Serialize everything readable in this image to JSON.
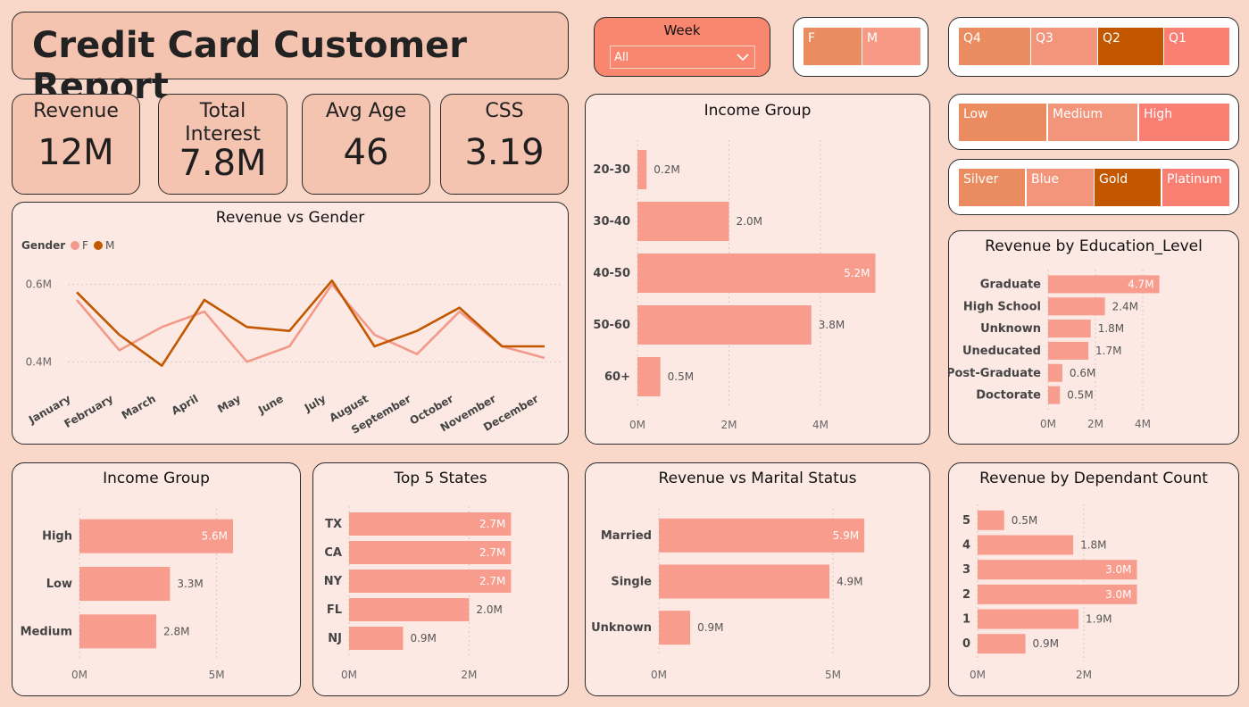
{
  "header": {
    "title": "Credit Card Customer Report"
  },
  "week_filter": {
    "label": "Week",
    "value": "All"
  },
  "gender_slicer": [
    {
      "label": "F",
      "color": "#ea8c60"
    },
    {
      "label": "M",
      "color": "#f79a85"
    }
  ],
  "quarter_slicer": [
    {
      "label": "Q4",
      "color": "#ea8c60"
    },
    {
      "label": "Q3",
      "color": "#f3957b"
    },
    {
      "label": "Q2",
      "color": "#c25700"
    },
    {
      "label": "Q1",
      "color": "#f87f72"
    }
  ],
  "income_slicer": [
    {
      "label": "Low",
      "color": "#ea8c60"
    },
    {
      "label": "Medium",
      "color": "#f3957b"
    },
    {
      "label": "High",
      "color": "#f87f72"
    }
  ],
  "card_slicer": [
    {
      "label": "Silver",
      "color": "#ea8c60"
    },
    {
      "label": "Blue",
      "color": "#f3957b"
    },
    {
      "label": "Gold",
      "color": "#c25700"
    },
    {
      "label": "Platinum",
      "color": "#f87f72"
    }
  ],
  "kpis": [
    {
      "label": "Revenue",
      "value": "12M"
    },
    {
      "label": "Total Interest",
      "value": "7.8M"
    },
    {
      "label": "Avg Age",
      "value": "46"
    },
    {
      "label": "CSS",
      "value": "3.19"
    }
  ],
  "colors": {
    "bar": "#f89c8e",
    "F": "#f2998a",
    "M": "#c25700"
  },
  "chart_data": [
    {
      "type": "line",
      "title": "Revenue vs Gender",
      "legend_title": "Gender",
      "legend_position": "top-left",
      "categories": [
        "January",
        "February",
        "March",
        "April",
        "May",
        "June",
        "July",
        "August",
        "September",
        "October",
        "November",
        "December"
      ],
      "series": [
        {
          "name": "F",
          "values": [
            0.56,
            0.43,
            0.49,
            0.53,
            0.4,
            0.44,
            0.6,
            0.47,
            0.42,
            0.53,
            0.44,
            0.41
          ]
        },
        {
          "name": "M",
          "values": [
            0.58,
            0.47,
            0.39,
            0.56,
            0.49,
            0.48,
            0.61,
            0.44,
            0.48,
            0.54,
            0.44,
            0.44
          ]
        }
      ],
      "y_ticks": [
        "0.4M",
        "0.6M"
      ],
      "ylim": [
        0.35,
        0.65
      ]
    },
    {
      "type": "bar",
      "orientation": "horizontal",
      "title": "Income Group",
      "categories": [
        "20-30",
        "30-40",
        "40-50",
        "50-60",
        "60+"
      ],
      "values": [
        0.2,
        2.0,
        5.2,
        3.8,
        0.5
      ],
      "labels": [
        "0.2M",
        "2.0M",
        "5.2M",
        "3.8M",
        "0.5M"
      ],
      "x_ticks": [
        "0M",
        "2M",
        "4M"
      ],
      "xlim": [
        0,
        5.6
      ]
    },
    {
      "type": "bar",
      "orientation": "horizontal",
      "title": "Revenue by Education_Level",
      "categories": [
        "Graduate",
        "High School",
        "Unknown",
        "Uneducated",
        "Post-Graduate",
        "Doctorate"
      ],
      "values": [
        4.7,
        2.4,
        1.8,
        1.7,
        0.6,
        0.5
      ],
      "labels": [
        "4.7M",
        "2.4M",
        "1.8M",
        "1.7M",
        "0.6M",
        "0.5M"
      ],
      "x_ticks": [
        "0M",
        "2M",
        "4M"
      ],
      "xlim": [
        0,
        6
      ]
    },
    {
      "type": "bar",
      "orientation": "horizontal",
      "title": "Income Group",
      "categories": [
        "High",
        "Low",
        "Medium"
      ],
      "values": [
        5.6,
        3.3,
        2.8
      ],
      "labels": [
        "5.6M",
        "3.3M",
        "2.8M"
      ],
      "x_ticks": [
        "0M",
        "5M"
      ],
      "xlim": [
        0,
        7
      ]
    },
    {
      "type": "bar",
      "orientation": "horizontal",
      "title": "Top 5 States",
      "categories": [
        "TX",
        "CA",
        "NY",
        "FL",
        "NJ"
      ],
      "values": [
        2.7,
        2.7,
        2.7,
        2.0,
        0.9
      ],
      "labels": [
        "2.7M",
        "2.7M",
        "2.7M",
        "2.0M",
        "0.9M"
      ],
      "x_ticks": [
        "0M",
        "2M"
      ],
      "xlim": [
        0,
        3.2
      ]
    },
    {
      "type": "bar",
      "orientation": "horizontal",
      "title": "Revenue vs Marital Status",
      "categories": [
        "Married",
        "Single",
        "Unknown"
      ],
      "values": [
        5.9,
        4.9,
        0.9
      ],
      "labels": [
        "5.9M",
        "4.9M",
        "0.9M"
      ],
      "x_ticks": [
        "0M",
        "5M"
      ],
      "xlim": [
        0,
        7
      ]
    },
    {
      "type": "bar",
      "orientation": "horizontal",
      "title": "Revenue by Dependant Count",
      "categories": [
        "5",
        "4",
        "3",
        "2",
        "1",
        "0"
      ],
      "values": [
        0.5,
        1.8,
        3.0,
        3.0,
        1.9,
        0.9
      ],
      "labels": [
        "0.5M",
        "1.8M",
        "3.0M",
        "3.0M",
        "1.9M",
        "0.9M"
      ],
      "x_ticks": [
        "0M",
        "2M"
      ],
      "xlim": [
        0,
        4
      ]
    }
  ]
}
